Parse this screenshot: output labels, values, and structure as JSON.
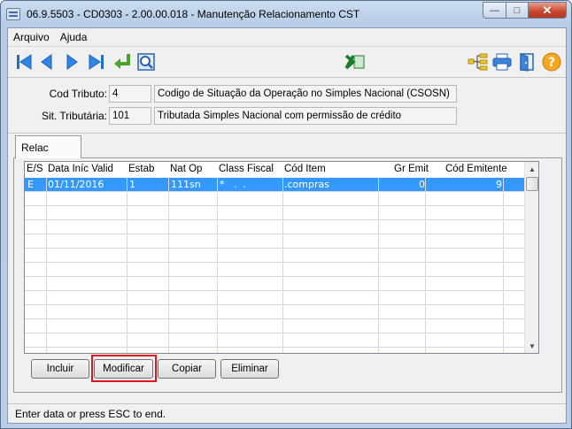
{
  "window": {
    "title": "06.9.5503 - CD0303 - 2.00.00.018 - Manutenção Relacionamento CST",
    "controls": {
      "minimize": "—",
      "maximize": "□",
      "close": "✕"
    }
  },
  "menu": {
    "items": [
      {
        "label": "Arquivo"
      },
      {
        "label": "Ajuda"
      }
    ]
  },
  "toolbar": {
    "icons": [
      "first-record-icon",
      "previous-record-icon",
      "next-record-icon",
      "last-record-icon",
      "goto-return-icon",
      "search-zoom-icon",
      "excel-icon",
      "tree-structure-icon",
      "print-icon",
      "exit-door-icon",
      "help-icon"
    ]
  },
  "header": {
    "cod_tributo_label": "Cod Tributo:",
    "cod_tributo_value": "4",
    "cod_tributo_desc": "Codigo de Situação da Operação no Simples Nacional (CSOSN)",
    "sit_tributaria_label": "Sit. Tributária:",
    "sit_tributaria_value": "101",
    "sit_tributaria_desc": "Tributada Simples Nacional com permissão de crédito"
  },
  "tabs": [
    {
      "label": "Relac"
    }
  ],
  "grid": {
    "columns": [
      "E/S",
      "Data Iníc Valid",
      "Estab",
      "Nat Op",
      "Class Fiscal",
      "Cód Item",
      "Gr Emit",
      "Cód Emitente"
    ],
    "rows": [
      {
        "es": "E",
        "data": "01/11/2016",
        "estab": "1",
        "natop": "111sn",
        "classfiscal": "*   .  .",
        "coditem": ".compras",
        "gremit": "0",
        "codemitente": "9"
      }
    ]
  },
  "buttons": {
    "incluir": "Incluir",
    "modificar": "Modificar",
    "copiar": "Copiar",
    "eliminar": "Eliminar"
  },
  "status": {
    "message": "Enter data or press ESC to end."
  }
}
